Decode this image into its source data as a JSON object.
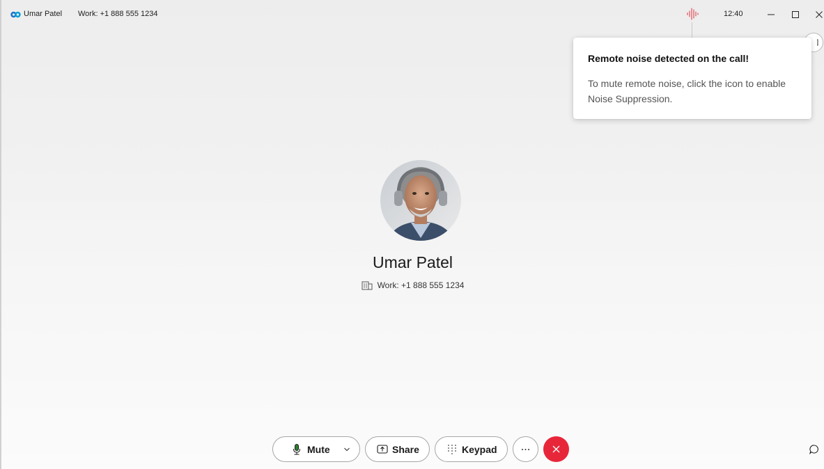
{
  "titlebar": {
    "contact_name": "Umar Patel",
    "phone": "Work: +1 888 555 1234",
    "time": "12:40",
    "logo_icon": "webex-logo-icon",
    "noise_icon": "noise-waveform-icon",
    "minimize_icon": "minimize-icon",
    "maximize_icon": "maximize-icon",
    "close_icon": "close-icon"
  },
  "notification": {
    "title": "Remote noise detected on the call!",
    "body": "To mute remote noise, click the icon to enable Noise Suppression."
  },
  "contact": {
    "name": "Umar Patel",
    "phone": "Work: +1 888 555 1234",
    "phone_icon": "building-icon"
  },
  "controls": {
    "mute_label": "Mute",
    "share_label": "Share",
    "keypad_label": "Keypad",
    "more_icon": "ellipsis-icon",
    "end_call_icon": "close-icon",
    "chat_icon": "chat-bubble-icon"
  },
  "colors": {
    "end_call": "#e8263a",
    "noise_icon": "#e0404c",
    "mic_green": "#2e7d32"
  }
}
